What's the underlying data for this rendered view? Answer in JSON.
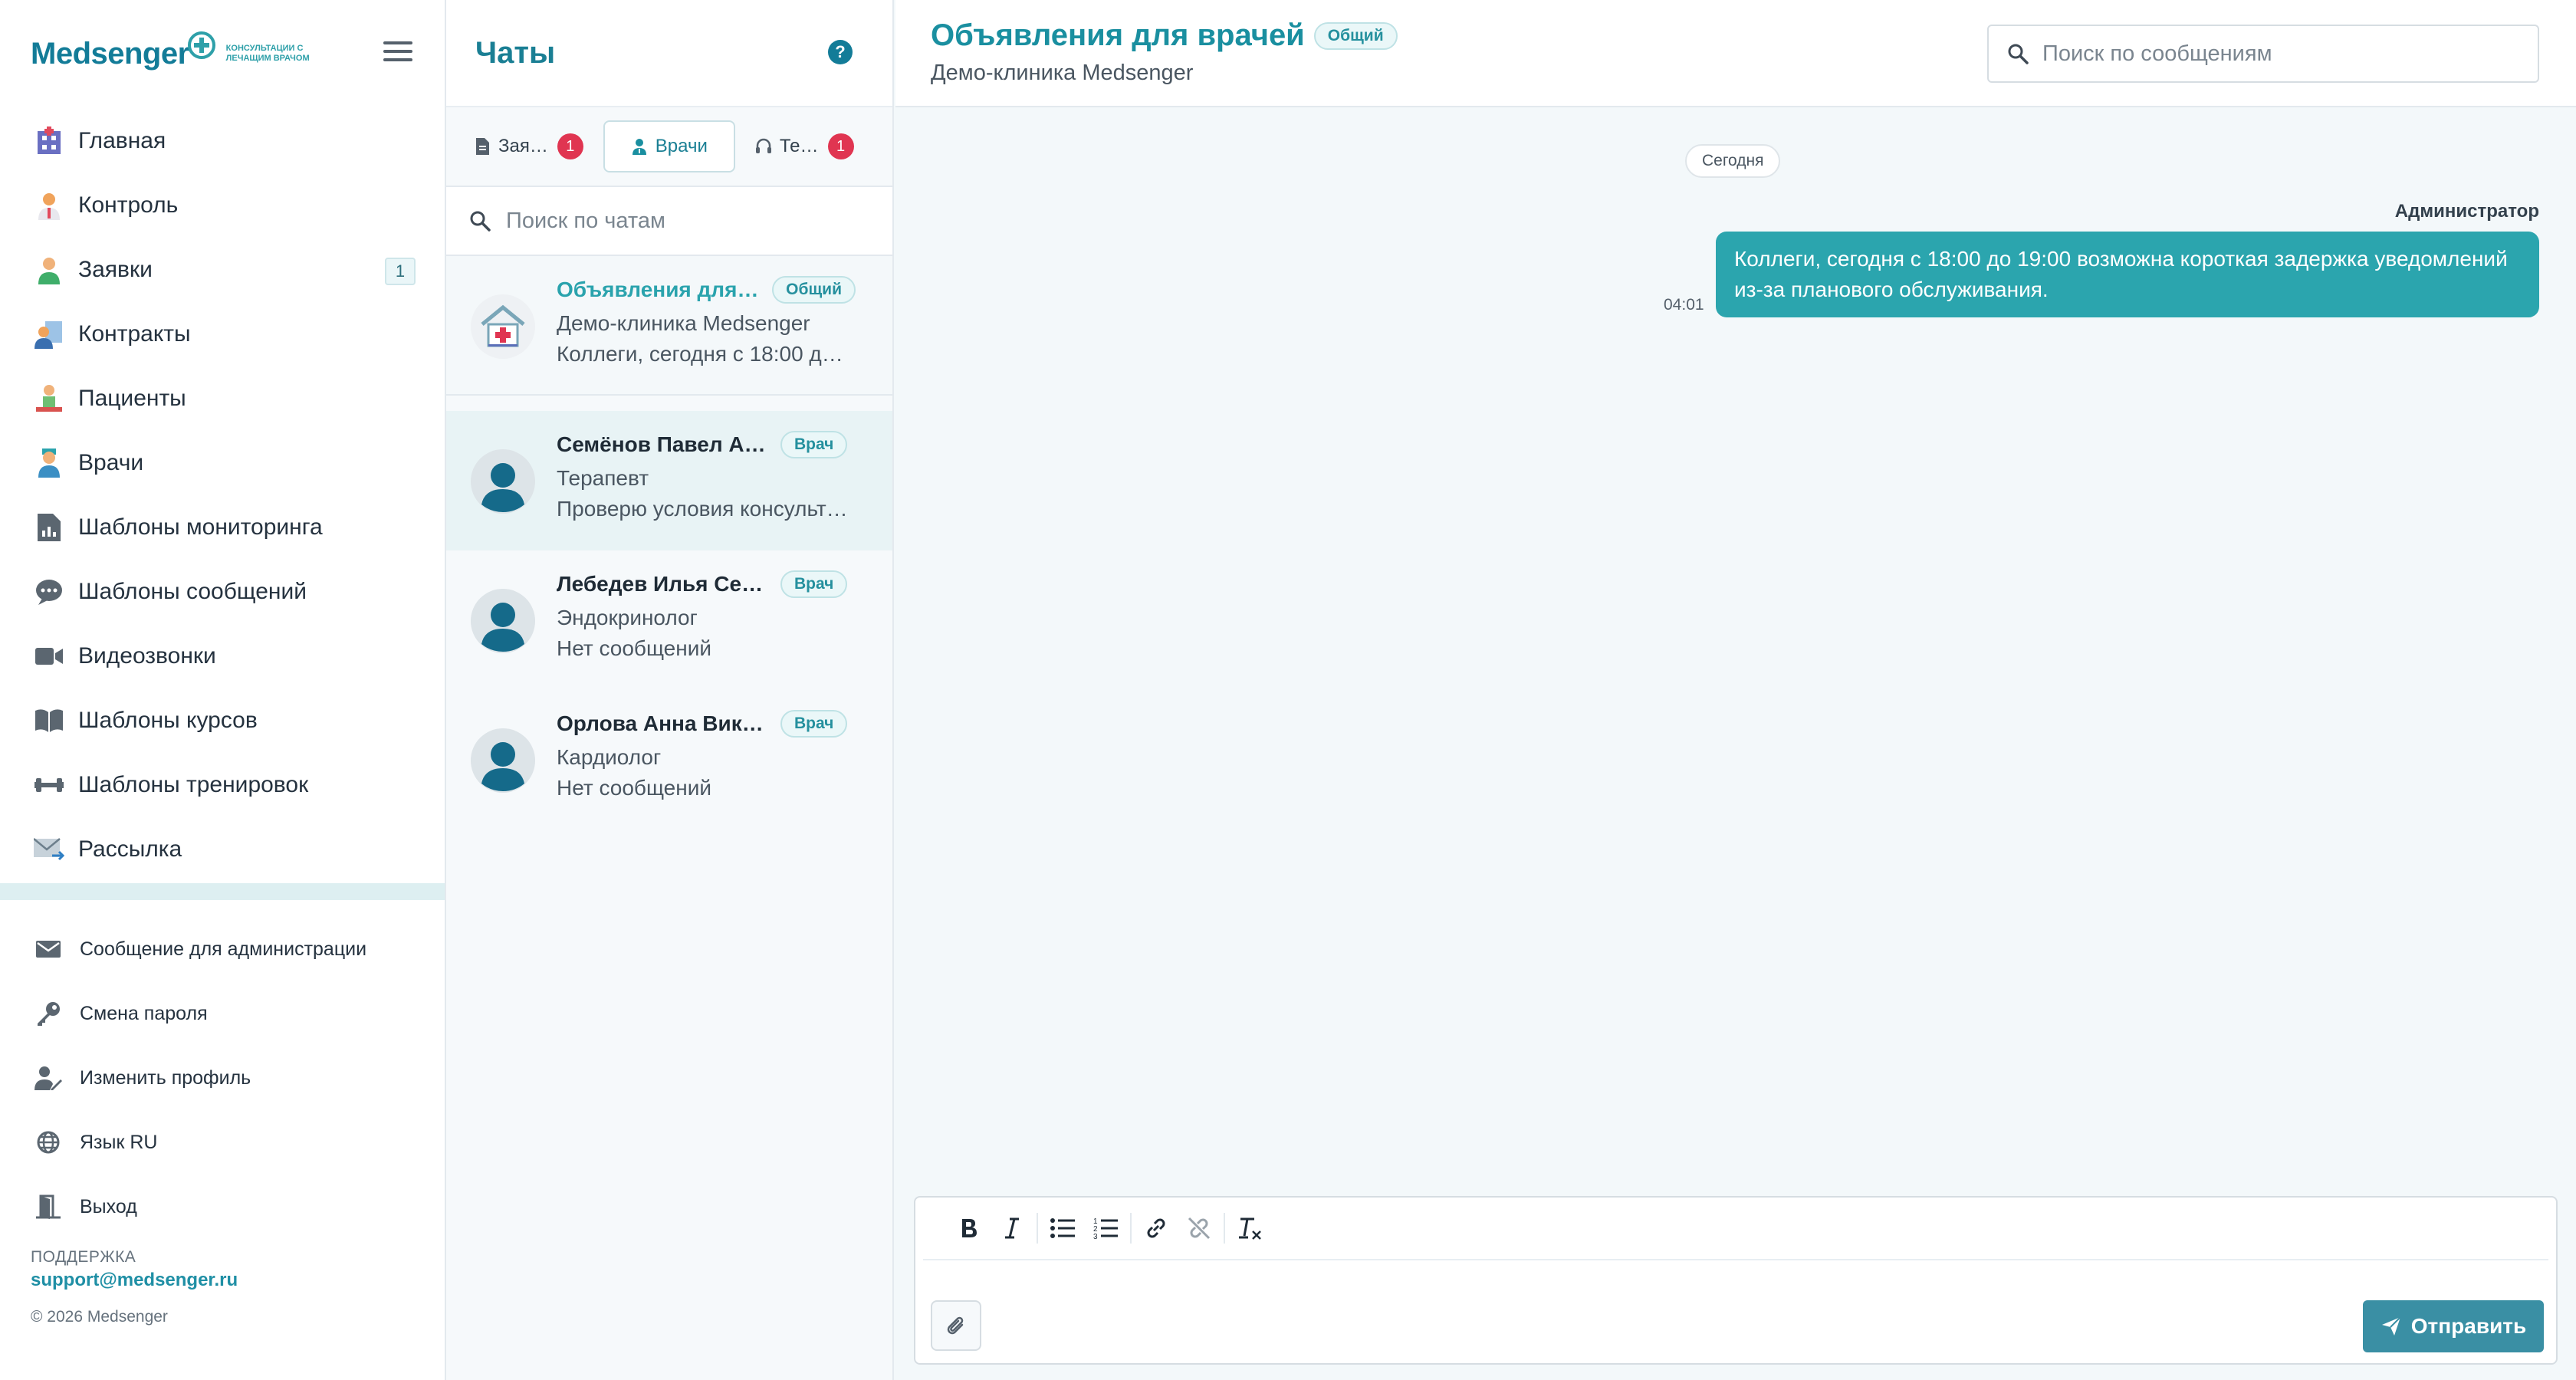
{
  "brand": {
    "name": "Medsenger",
    "tagline": "консультации с лечащим врачом"
  },
  "nav": [
    {
      "label": "Главная",
      "icon": "hospital-icon"
    },
    {
      "label": "Контроль",
      "icon": "doctor-icon"
    },
    {
      "label": "Заявки",
      "icon": "user-green-icon",
      "badge": "1"
    },
    {
      "label": "Контракты",
      "icon": "contract-icon"
    },
    {
      "label": "Пациенты",
      "icon": "patient-icon"
    },
    {
      "label": "Врачи",
      "icon": "physician-icon"
    },
    {
      "label": "Шаблоны мониторинга",
      "icon": "file-chart-icon"
    },
    {
      "label": "Шаблоны сообщений",
      "icon": "comment-icon"
    },
    {
      "label": "Видеозвонки",
      "icon": "video-icon"
    },
    {
      "label": "Шаблоны курсов",
      "icon": "book-icon"
    },
    {
      "label": "Шаблоны тренировок",
      "icon": "dumbbell-icon"
    },
    {
      "label": "Рассылка",
      "icon": "envelope-color-icon"
    }
  ],
  "system": [
    {
      "label": "Сообщение для администрации",
      "icon": "envelope-icon"
    },
    {
      "label": "Смена пароля",
      "icon": "key-icon"
    },
    {
      "label": "Изменить профиль",
      "icon": "user-edit-icon"
    },
    {
      "label": "Язык RU",
      "icon": "globe-icon"
    },
    {
      "label": "Выход",
      "icon": "door-exit-icon"
    }
  ],
  "support": {
    "title": "ПОДДЕРЖКА",
    "email": "support@medsenger.ru",
    "copyright": "© 2026 Medsenger"
  },
  "chats": {
    "title": "Чаты",
    "help": "?",
    "tabs": [
      {
        "label": "Зая…",
        "badge": "1",
        "icon": "file-icon"
      },
      {
        "label": "Врачи",
        "badge": "",
        "icon": "user-doctor-icon",
        "active": true
      },
      {
        "label": "Те…",
        "badge": "1",
        "icon": "headset-icon"
      }
    ],
    "search_placeholder": "Поиск по чатам",
    "items": [
      {
        "name": "Объявления для …",
        "tag": "Общий",
        "sub": "Демо-клиника Medsenger",
        "preview": "Коллеги, сегодня с 18:00 д…"
      },
      {
        "name": "Семёнов Павел Ан…",
        "tag": "Врач",
        "sub": "Терапевт",
        "preview": "Проверю условия консульт…"
      },
      {
        "name": "Лебедев Илья Серг…",
        "tag": "Врач",
        "sub": "Эндокринолог",
        "preview": "Нет сообщений"
      },
      {
        "name": "Орлова Анна Викто…",
        "tag": "Врач",
        "sub": "Кардиолог",
        "preview": "Нет сообщений"
      }
    ]
  },
  "conversation": {
    "title": "Объявления для врачей",
    "tag": "Общий",
    "subtitle": "Демо-клиника Medsenger",
    "search_placeholder": "Поиск по сообщениям",
    "day": "Сегодня",
    "messages": [
      {
        "sender": "Администратор",
        "text": "Коллеги, сегодня с 18:00 до 19:00 возможна короткая задержка уведомлений из-за планового обслуживания.",
        "time": "04:01"
      }
    ]
  },
  "composer": {
    "send_label": "Отправить"
  },
  "colors": {
    "brand": "#137c98",
    "accent": "#2ba5ae",
    "badge": "#e03551"
  }
}
